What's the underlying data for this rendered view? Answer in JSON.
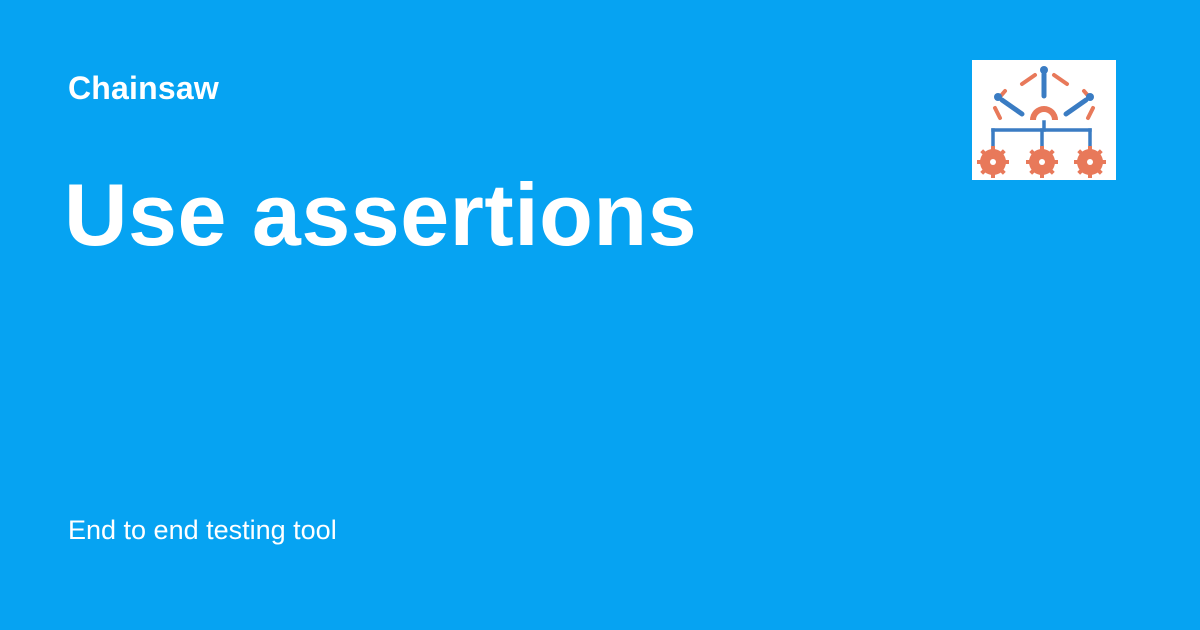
{
  "card": {
    "site_name": "Chainsaw",
    "title": "Use assertions",
    "tagline": "End to end testing tool"
  },
  "logo": {
    "icon": "chainsaw-logo-icon",
    "colors": {
      "background": "#ffffff",
      "orange": "#e8795a",
      "blue": "#3a7cc3"
    }
  },
  "colors": {
    "background": "#06a3f2",
    "text": "#ffffff"
  }
}
